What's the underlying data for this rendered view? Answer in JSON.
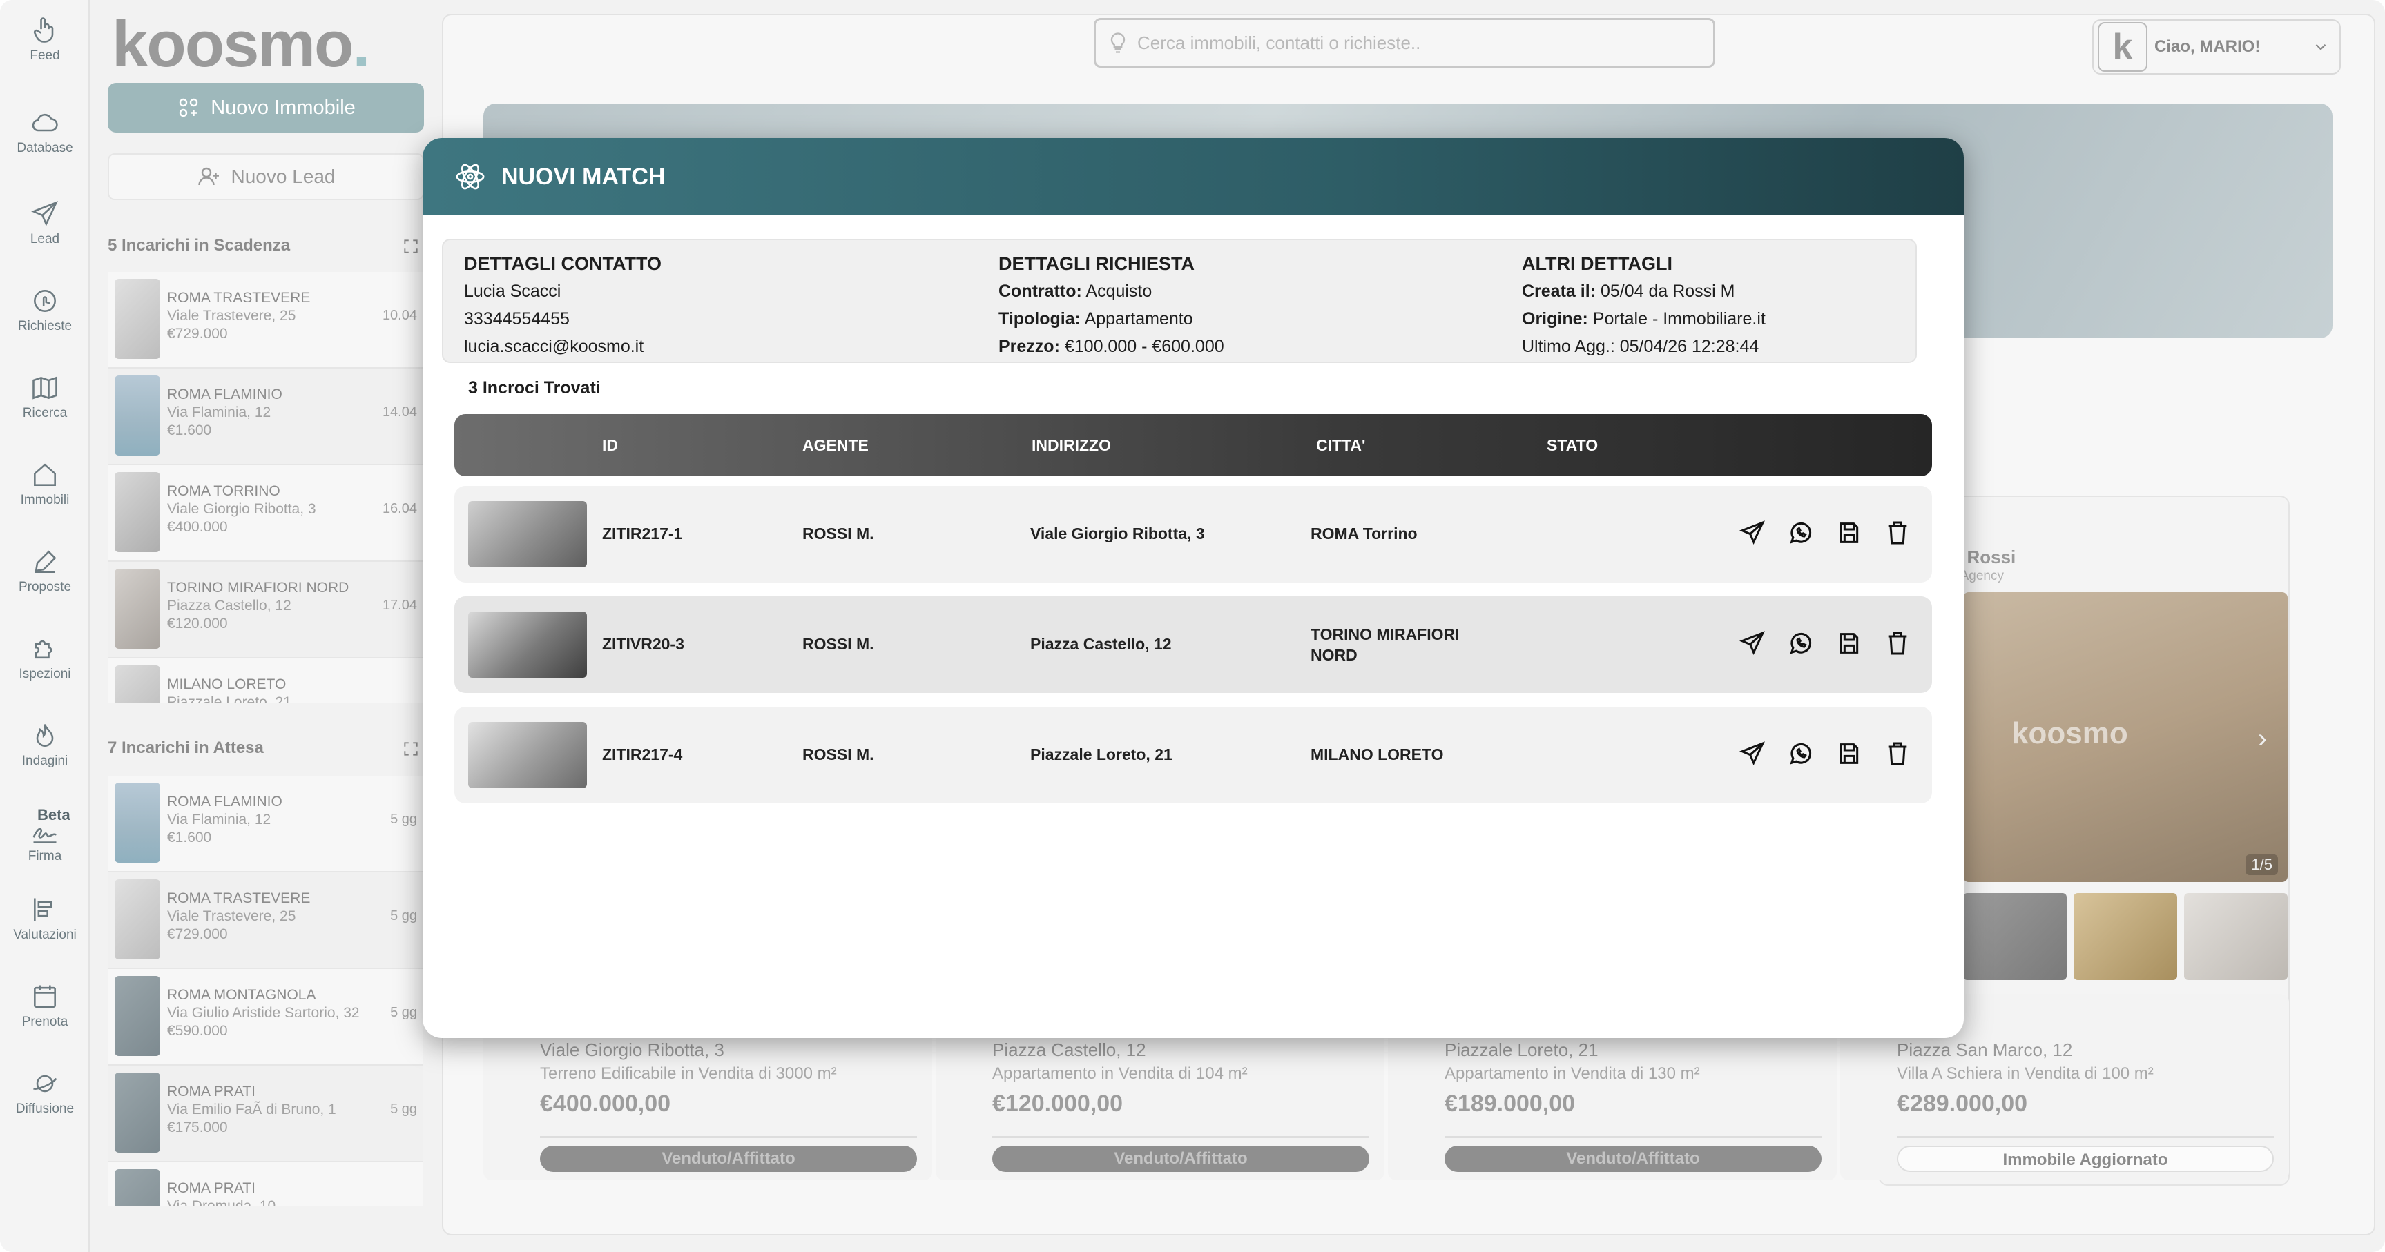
{
  "rail": [
    {
      "label": "Feed",
      "icon": "hand-pointer-icon"
    },
    {
      "label": "Database",
      "icon": "cloud-icon"
    },
    {
      "label": "Lead",
      "icon": "paper-plane-icon"
    },
    {
      "label": "Richieste",
      "icon": "touch-icon"
    },
    {
      "label": "Ricerca",
      "icon": "map-icon"
    },
    {
      "label": "Immobili",
      "icon": "home-icon"
    },
    {
      "label": "Proposte",
      "icon": "pen-icon"
    },
    {
      "label": "Ispezioni",
      "icon": "puzzle-icon"
    },
    {
      "label": "Indagini",
      "icon": "flame-icon"
    },
    {
      "label": "Firma",
      "icon": "signature-icon",
      "badge": "Beta"
    },
    {
      "label": "Valutazioni",
      "icon": "bars-icon"
    },
    {
      "label": "Prenota",
      "icon": "calendar-icon"
    },
    {
      "label": "Diffusione",
      "icon": "planet-icon"
    }
  ],
  "sidebar": {
    "logo": "koosmo",
    "logo_dot": ".",
    "new_property": "Nuovo Immobile",
    "new_lead": "Nuovo Lead",
    "expiring_title": "5 Incarichi in Scadenza",
    "expiring": [
      {
        "title": "ROMA TRASTEVERE",
        "address": "Viale Trastevere, 25",
        "price": "€729.000",
        "date": "10.04"
      },
      {
        "title": "ROMA FLAMINIO",
        "address": "Via Flaminia, 12",
        "price": "€1.600",
        "date": "14.04"
      },
      {
        "title": "ROMA TORRINO",
        "address": "Viale Giorgio Ribotta, 3",
        "price": "€400.000",
        "date": "16.04"
      },
      {
        "title": "TORINO MIRAFIORI NORD",
        "address": "Piazza Castello, 12",
        "price": "€120.000",
        "date": "17.04"
      },
      {
        "title": "MILANO LORETO",
        "address": "Piazzale Loreto, 21",
        "price": "",
        "date": ""
      }
    ],
    "waiting_title": "7 Incarichi in Attesa",
    "waiting": [
      {
        "title": "ROMA FLAMINIO",
        "address": "Via Flaminia, 12",
        "price": "€1.600",
        "date": "5 gg"
      },
      {
        "title": "ROMA TRASTEVERE",
        "address": "Viale Trastevere, 25",
        "price": "€729.000",
        "date": "5 gg"
      },
      {
        "title": "ROMA MONTAGNOLA",
        "address": "Via Giulio Aristide Sartorio, 32",
        "price": "€590.000",
        "date": "5 gg"
      },
      {
        "title": "ROMA PRATI",
        "address": "Via Emilio FaÃ  di Bruno, 1",
        "price": "€175.000",
        "date": "5 gg"
      },
      {
        "title": "ROMA PRATI",
        "address": "Via Dromuda, 10",
        "price": "",
        "date": ""
      }
    ]
  },
  "header": {
    "search_placeholder": "Cerca immobili, contatti o richieste..",
    "greeting": "Ciao, MARIO!",
    "avatar_letter": "k"
  },
  "agency": {
    "name": "rio Rossi",
    "sub": "mo Agency",
    "watermark": "koosmo",
    "counter": "1/5"
  },
  "properties": [
    {
      "title": "",
      "address": "Viale Giorgio Ribotta, 3",
      "desc": "Terreno Edificabile in Vendita di 3000 m²",
      "price": "€400.000,00",
      "status": "Venduto/Affittato"
    },
    {
      "title": "",
      "address": "Piazza Castello, 12",
      "desc": "Appartamento in Vendita di 104 m²",
      "price": "€120.000,00",
      "status": "Venduto/Affittato"
    },
    {
      "title": "",
      "address": "Piazzale Loreto, 21",
      "desc": "Appartamento in Vendita di 130 m²",
      "price": "€189.000,00",
      "status": "Venduto/Affittato"
    },
    {
      "title": "A",
      "address": "Piazza San Marco, 12",
      "desc": "Villa A Schiera in Vendita di 100 m²",
      "price": "€289.000,00",
      "status": "Immobile Aggiornato"
    }
  ],
  "modal": {
    "title": "NUOVI MATCH",
    "contact": {
      "heading": "DETTAGLI CONTATTO",
      "name": "Lucia Scacci",
      "phone": "33344554455",
      "email": "lucia.scacci@koosmo.it"
    },
    "request": {
      "heading": "DETTAGLI RICHIESTA",
      "contract_label": "Contratto:",
      "contract": "Acquisto",
      "type_label": "Tipologia:",
      "type": "Appartamento",
      "price_label": "Prezzo:",
      "price": "€100.000 - €600.000"
    },
    "other": {
      "heading": "ALTRI DETTAGLI",
      "created_label": "Creata il:",
      "created": "05/04 da Rossi M",
      "origin_label": "Origine:",
      "origin": "Portale - Immobiliare.it",
      "updated": "Ultimo Agg.: 05/04/26 12:28:44"
    },
    "found": "3 Incroci Trovati",
    "columns": [
      "ID",
      "AGENTE",
      "INDIRIZZO",
      "CITTA'",
      "STATO"
    ],
    "rows": [
      {
        "id": "ZITIR217-1",
        "agent": "ROSSI M.",
        "address": "Viale Giorgio Ribotta, 3",
        "city": "ROMA Torrino",
        "city2": "",
        "status": ""
      },
      {
        "id": "ZITIVR20-3",
        "agent": "ROSSI M.",
        "address": "Piazza Castello, 12",
        "city": "TORINO MIRAFIORI",
        "city2": "NORD",
        "status": ""
      },
      {
        "id": "ZITIR217-4",
        "agent": "ROSSI M.",
        "address": "Piazzale Loreto, 21",
        "city": "MILANO LORETO",
        "city2": "",
        "status": ""
      }
    ]
  }
}
